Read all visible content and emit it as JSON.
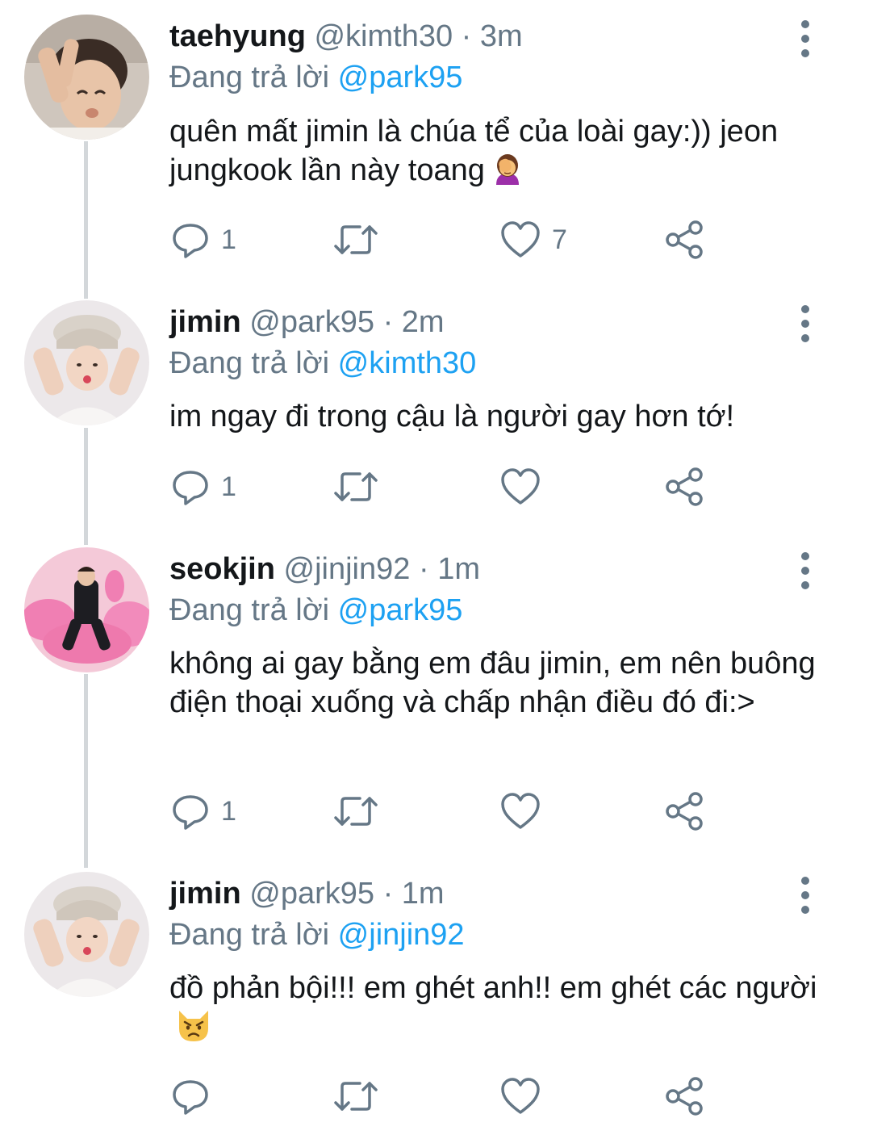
{
  "tweets": [
    {
      "name": "taehyung",
      "handle": "@kimth30",
      "dot": "·",
      "time": "3m",
      "replying_prefix": "Đang trả lời",
      "replying_to": "@park95",
      "text": "quên mất jimin là chúa tể của loài gay:)) jeon jungkook lần này toang",
      "emoji": "person-facepalming-emoji",
      "replies": "1",
      "retweets": "",
      "likes": "7",
      "avatar_bg": "#cfc6bd"
    },
    {
      "name": "jimin",
      "handle": "@park95",
      "dot": "·",
      "time": "2m",
      "replying_prefix": "Đang trả lời",
      "replying_to": "@kimth30",
      "text": "im ngay đi trong cậu là người gay hơn tớ!",
      "replies": "1",
      "retweets": "",
      "likes": "",
      "avatar_bg": "#ece8ea"
    },
    {
      "name": "seokjin",
      "handle": "@jinjin92",
      "dot": "·",
      "time": "1m",
      "replying_prefix": "Đang trả lời",
      "replying_to": "@park95",
      "text": "không ai gay bằng em đâu jimin, em nên buông điện thoại xuống và chấp nhận điều đó đi:>",
      "replies": "1",
      "retweets": "",
      "likes": "",
      "avatar_bg": "#f4c9d8"
    },
    {
      "name": "jimin",
      "handle": "@park95",
      "dot": "·",
      "time": "1m",
      "replying_prefix": "Đang trả lời",
      "replying_to": "@jinjin92",
      "text": "đồ phản bội!!! em ghét anh!! em ghét các người",
      "emoji": "pouting-cat-emoji",
      "replies": "",
      "retweets": "",
      "likes": "",
      "avatar_bg": "#ece8ea"
    }
  ],
  "colors": {
    "link": "#1da1f2",
    "muted": "#657786",
    "text": "#14171a",
    "thread_line": "#d3d7da"
  },
  "icons": [
    "reply-icon",
    "retweet-icon",
    "like-icon",
    "share-icon",
    "more-options-icon"
  ]
}
